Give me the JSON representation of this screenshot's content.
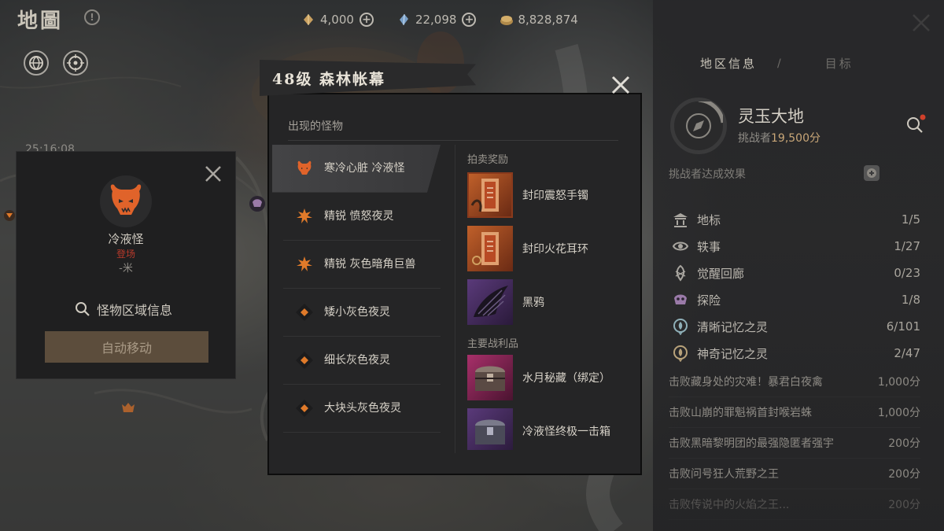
{
  "topbar": {
    "title": "地圖",
    "currencies": [
      {
        "icon": "gold-shard-icon",
        "value": "4,000"
      },
      {
        "icon": "blue-shard-icon",
        "value": "22,098"
      },
      {
        "icon": "coin-bag-icon",
        "value": "8,828,874"
      }
    ]
  },
  "map": {
    "timer": "25:16:08"
  },
  "monster_card": {
    "name": "冷液怪",
    "status": "登场",
    "distance": "-米",
    "search_label": "怪物区域信息",
    "auto_move_label": "自动移动"
  },
  "dialog": {
    "title": "48级 森林帐幕",
    "section_title": "出现的怪物",
    "monsters": [
      {
        "label": "寒冷心脏 冷液怪",
        "type": "boss",
        "selected": true
      },
      {
        "label": "精锐 愤怒夜灵",
        "type": "elite"
      },
      {
        "label": "精锐 灰色暗角巨兽",
        "type": "elite"
      },
      {
        "label": "矮小灰色夜灵",
        "type": "normal"
      },
      {
        "label": "细长灰色夜灵",
        "type": "normal"
      },
      {
        "label": "大块头灰色夜灵",
        "type": "normal"
      }
    ],
    "auction_title": "拍卖奖励",
    "auction_items": [
      {
        "label": "封印震怒手镯",
        "icon": "sealed-bracelet-icon"
      },
      {
        "label": "封印火花耳环",
        "icon": "sealed-earring-icon"
      },
      {
        "label": "黑鸦",
        "icon": "black-crow-wing-icon"
      }
    ],
    "loot_title": "主要战利品",
    "loot_items": [
      {
        "label": "水月秘藏（绑定）",
        "icon": "treasure-chest-icon"
      },
      {
        "label": "冷液怪终极一击箱",
        "icon": "purple-chest-icon"
      }
    ]
  },
  "region": {
    "tabs": [
      {
        "label": "地区信息",
        "active": true
      },
      {
        "label": "目标",
        "active": false
      }
    ],
    "tab_separator": "/",
    "name": "灵玉大地",
    "score_prefix": "挑战者",
    "score_value": "19,500分",
    "effect_label": "挑战者达成效果",
    "stats": [
      {
        "icon": "landmark-icon",
        "label": "地标",
        "value": "1/5"
      },
      {
        "icon": "anecdote-icon",
        "label": "轶事",
        "value": "1/27"
      },
      {
        "icon": "awakening-icon",
        "label": "觉醒回廊",
        "value": "0/23"
      },
      {
        "icon": "explore-icon",
        "label": "探险",
        "value": "1/8"
      },
      {
        "icon": "clear-memory-icon",
        "label": "清晰记忆之灵",
        "value": "6/101"
      },
      {
        "icon": "strange-memory-icon",
        "label": "神奇记忆之灵",
        "value": "2/47"
      }
    ],
    "tasks": [
      {
        "label": "击败藏身处的灾难！暴君白夜禽",
        "value": "1,000分"
      },
      {
        "label": "击败山崩的罪魁祸首封喉岩蛛",
        "value": "1,000分"
      },
      {
        "label": "击败黑暗黎明团的最强隐匿者强宇",
        "value": "200分"
      },
      {
        "label": "击败问号狂人荒野之王",
        "value": "200分"
      },
      {
        "label": "击败传说中的火焰之王...",
        "value": "200分"
      }
    ]
  }
}
